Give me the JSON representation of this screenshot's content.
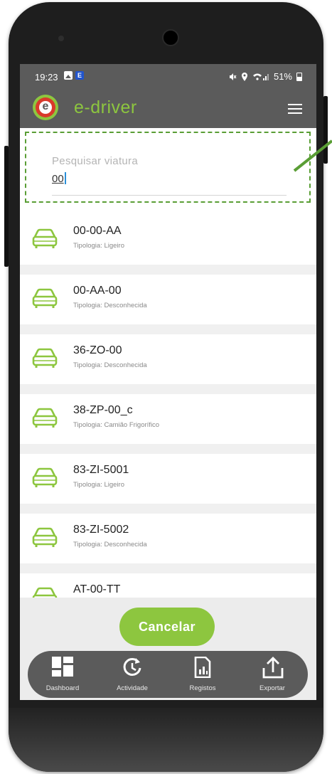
{
  "status_bar": {
    "time": "19:23",
    "battery": "51%"
  },
  "app_bar": {
    "brand": "e-driver"
  },
  "search": {
    "placeholder": "Pesquisar viatura",
    "value": "00"
  },
  "vehicles": [
    {
      "plate": "00-00-AA",
      "tipologia": "Tipologia: Ligeiro"
    },
    {
      "plate": "00-AA-00",
      "tipologia": "Tipologia: Desconhecida"
    },
    {
      "plate": "36-ZO-00",
      "tipologia": "Tipologia: Desconhecida"
    },
    {
      "plate": "38-ZP-00_c",
      "tipologia": "Tipologia: Camião Frigorífico"
    },
    {
      "plate": "83-ZI-5001",
      "tipologia": "Tipologia: Ligeiro"
    },
    {
      "plate": "83-ZI-5002",
      "tipologia": "Tipologia: Desconhecida"
    },
    {
      "plate": "AT-00-TT",
      "tipologia": ""
    }
  ],
  "cancel_button": {
    "label": "Cancelar"
  },
  "bottom_nav": [
    {
      "label": "Dashboard",
      "icon": "dashboard-icon"
    },
    {
      "label": "Actividade",
      "icon": "history-icon"
    },
    {
      "label": "Registos",
      "icon": "report-icon"
    },
    {
      "label": "Exportar",
      "icon": "export-icon"
    }
  ],
  "colors": {
    "accent": "#8dc63f",
    "bar": "#5b5b5b",
    "annotation": "#5a9e35"
  }
}
